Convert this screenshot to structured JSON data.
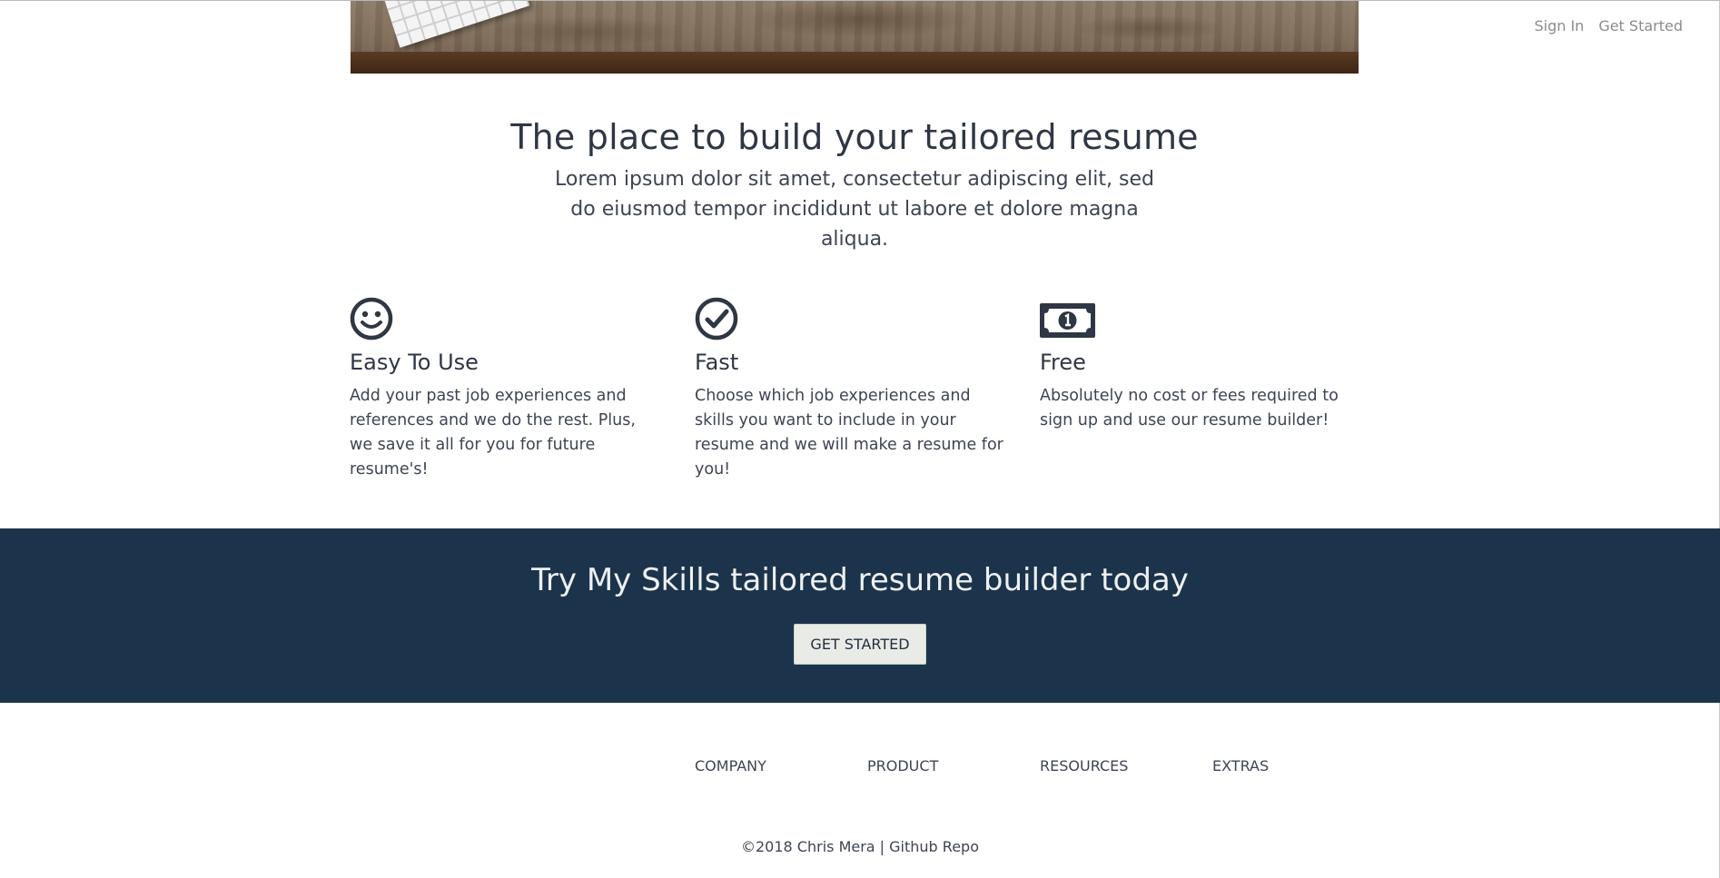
{
  "nav": {
    "sign_in": "Sign In",
    "get_started": "Get Started"
  },
  "hero": {
    "title": "The place to build your tailored resume",
    "subtitle": "Lorem ipsum dolor sit amet, consectetur adipiscing elit, sed do eiusmod tempor incididunt ut labore et dolore magna aliqua."
  },
  "features": [
    {
      "icon": "smile-icon",
      "title": "Easy To Use",
      "text": "Add your past job experiences and references and we do the rest. Plus, we save it all for you for future resume's!"
    },
    {
      "icon": "check-circle-icon",
      "title": "Fast",
      "text": "Choose which job experiences and skills you want to include in your resume and we will make a resume for you!"
    },
    {
      "icon": "money-bill-icon",
      "title": "Free",
      "text": "Absolutely no cost or fees required to sign up and use our resume builder!"
    }
  ],
  "cta": {
    "heading": "Try My Skills tailored resume builder today",
    "button": "GET STARTED"
  },
  "footer": {
    "links": [
      "COMPANY",
      "PRODUCT",
      "RESOURCES",
      "EXTRAS"
    ],
    "copyright": "©2018 Chris Mera | ",
    "repo_link": "Github Repo"
  },
  "colors": {
    "cta_background": "#1b344b",
    "text_dark": "#2f3644",
    "nav_gray": "#8c8c8c"
  }
}
